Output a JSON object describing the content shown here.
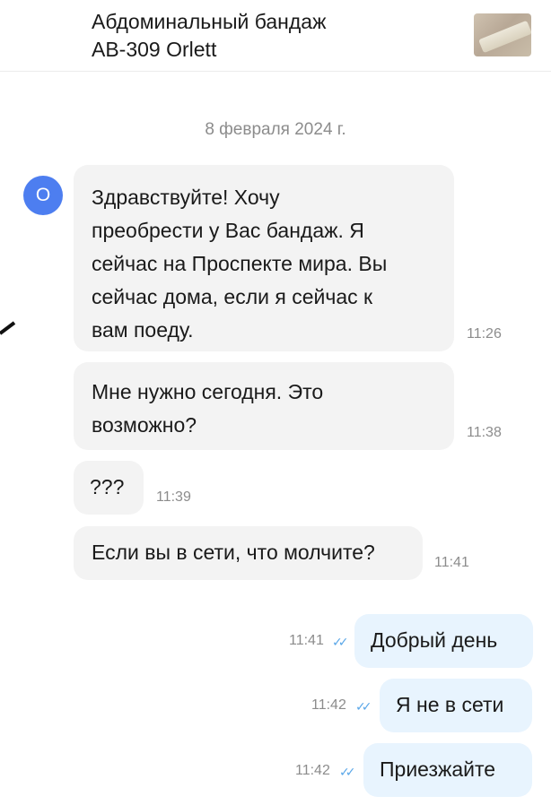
{
  "header": {
    "product_line1": "Абдоминальный бандаж",
    "product_line2": "AB-309 Orlett"
  },
  "date_separator": "8 февраля 2024 г.",
  "contact": {
    "avatar_letter": "O"
  },
  "messages": [
    {
      "text": "Здравствуйте! Хочу\nпреобрести у Вас бандаж. Я\nсейчас на Проспекте мира. Вы\nсейчас дома, если я сейчас к\nвам поеду.",
      "time": "11:26"
    },
    {
      "text": "Мне нужно сегодня. Это\nвозможно?",
      "time": "11:38"
    },
    {
      "text": "???",
      "time": "11:39"
    },
    {
      "text": "Если вы в сети, что молчите?",
      "time": "11:41"
    },
    {
      "text": "Добрый день",
      "time": "11:41"
    },
    {
      "text": "Я не в сети",
      "time": "11:42"
    },
    {
      "text": "Приезжайте",
      "time": "11:42"
    }
  ],
  "colors": {
    "incoming_bubble": "#f3f3f3",
    "outgoing_bubble": "#e8f4fe",
    "avatar": "#4d7ef0",
    "read_check": "#5aa7e8"
  },
  "icons": {
    "read_receipt": "double-check-icon"
  }
}
